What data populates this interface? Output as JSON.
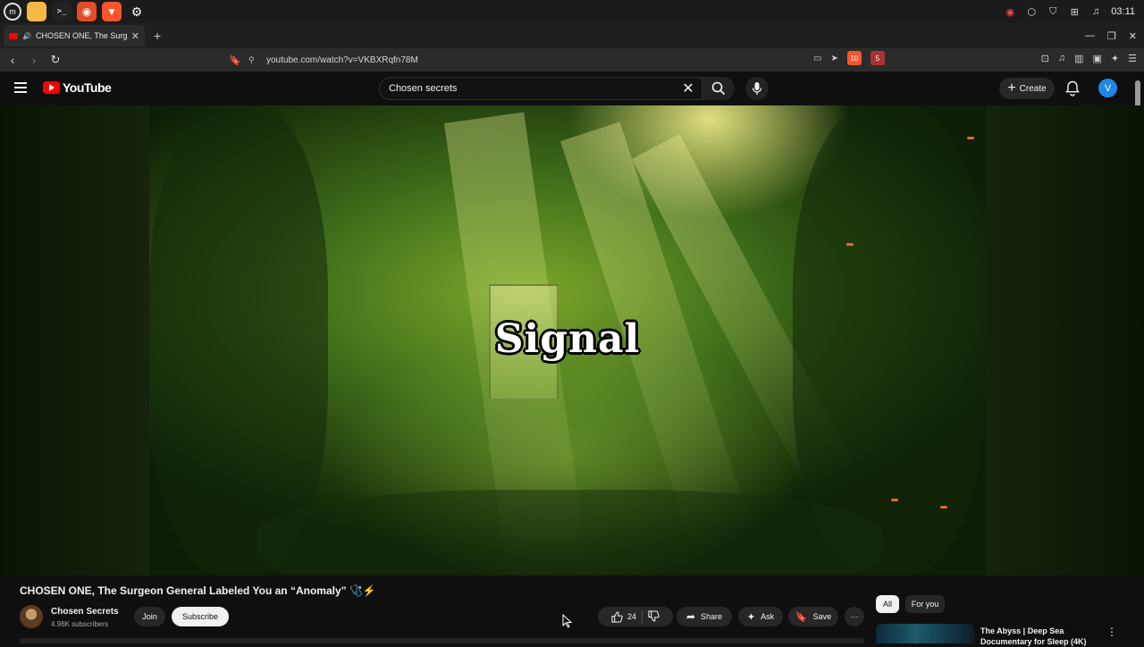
{
  "taskbar": {
    "apps": [
      {
        "name": "mint-menu-icon",
        "color": "#2a2a2a"
      },
      {
        "name": "files-icon",
        "color": "#f5b843"
      },
      {
        "name": "terminal-icon",
        "color": "#222222"
      },
      {
        "name": "ublock-icon",
        "color": "#e34c26"
      },
      {
        "name": "brave-icon",
        "color": "#fb542b"
      },
      {
        "name": "settings-icon",
        "color": "#2a2a2a"
      }
    ],
    "clock": "03:11"
  },
  "browser": {
    "tab_title": "CHOSEN ONE, The Surgeon",
    "url": "youtube.com/watch?v=VKBXRqfn78M",
    "brave_shield_count": "10",
    "rewards_count": "5"
  },
  "youtube": {
    "logo_text": "YouTube",
    "search_value": "Chosen secrets",
    "create_label": "Create",
    "avatar_letter": "V"
  },
  "player": {
    "caption": "Signal"
  },
  "video": {
    "title": "CHOSEN ONE, The Surgeon General Labeled You an “Anomaly” 🩺⚡",
    "channel_name": "Chosen Secrets",
    "subscribers": "4.96K subscribers",
    "join_label": "Join",
    "subscribe_label": "Subscribe",
    "like_count": "24",
    "share_label": "Share",
    "ask_label": "Ask",
    "save_label": "Save"
  },
  "sidebar": {
    "chips": [
      "All",
      "For you"
    ],
    "rec_title": "The Abyss | Deep Sea Documentary for Sleep (4K)"
  }
}
